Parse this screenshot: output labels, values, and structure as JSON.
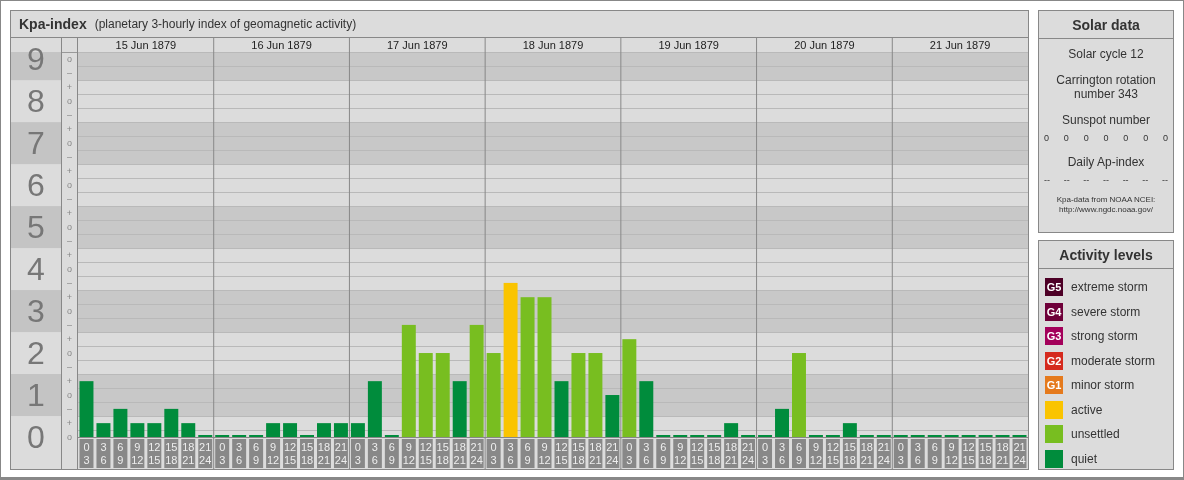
{
  "title": {
    "name": "Kpa-index",
    "subtitle": "(planetary 3-hourly index of geomagnetic activity)"
  },
  "kp_chart": {
    "days": [
      "15 Jun 1879",
      "16 Jun 1879",
      "17 Jun 1879",
      "18 Jun 1879",
      "19 Jun 1879",
      "20 Jun 1879",
      "21 Jun 1879"
    ],
    "scale_marks": [
      "o",
      "–",
      "+",
      "o",
      "–",
      "+",
      "o",
      "–",
      "+",
      "o",
      "–",
      "+",
      "o",
      "–",
      "+",
      "o",
      "–",
      "+",
      "o",
      "–",
      "+",
      "o",
      "–",
      "+",
      "o",
      "–",
      "+",
      "o"
    ],
    "chart_data": {
      "type": "bar",
      "grid": true,
      "ylim": [
        0,
        9.17
      ],
      "yticks": [
        {
          "value": 9,
          "label": "9"
        },
        {
          "value": 8,
          "label": "8"
        },
        {
          "value": 7,
          "label": "7"
        },
        {
          "value": 6,
          "label": "6"
        },
        {
          "value": 5,
          "label": "5"
        },
        {
          "value": 4,
          "label": "4"
        },
        {
          "value": 3,
          "label": "3"
        },
        {
          "value": 2,
          "label": "2"
        },
        {
          "value": 1,
          "label": "1"
        },
        {
          "value": 0,
          "label": "0"
        }
      ],
      "categories": [
        "0 3",
        "3 6",
        "6 9",
        "9 12",
        "12 15",
        "15 18",
        "18 21",
        "21 24",
        "0 3",
        "3 6",
        "6 9",
        "9 12",
        "12 15",
        "15 18",
        "18 21",
        "21 24",
        "0 3",
        "3 6",
        "6 9",
        "9 12",
        "12 15",
        "15 18",
        "18 21",
        "21 24",
        "0 3",
        "3 6",
        "6 9",
        "9 12",
        "12 15",
        "15 18",
        "18 21",
        "21 24",
        "0 3",
        "3 6",
        "6 9",
        "9 12",
        "12 15",
        "15 18",
        "18 21",
        "21 24",
        "0 3",
        "3 6",
        "6 9",
        "9 12",
        "12 15",
        "15 18",
        "18 21",
        "21 24",
        "0 3",
        "3 6",
        "6 9",
        "9 12",
        "12 15",
        "15 18",
        "18 21",
        "21 24"
      ],
      "series": [
        {
          "color": "#008c3c",
          "values": [
            1.33,
            0.33,
            0.67,
            0.33,
            0.33,
            0.67,
            0.33,
            0,
            0,
            0,
            0,
            0.33,
            0.33,
            0,
            0.33,
            0.33,
            0.33,
            1.33,
            0,
            null,
            null,
            null,
            1.33,
            null,
            null,
            null,
            null,
            null,
            1.33,
            null,
            null,
            1,
            null,
            1.33,
            0,
            0,
            0,
            0,
            0.33,
            0,
            0,
            0.67,
            null,
            0,
            0,
            0.33,
            0,
            0,
            0,
            0,
            0,
            0,
            0,
            0,
            0,
            0
          ]
        },
        {
          "color": "#78be20",
          "values": [
            null,
            null,
            null,
            null,
            null,
            null,
            null,
            null,
            null,
            null,
            null,
            null,
            null,
            null,
            null,
            null,
            null,
            null,
            null,
            2.67,
            2,
            2,
            null,
            2.67,
            2,
            null,
            3.33,
            3.33,
            null,
            2,
            2,
            null,
            2.33,
            null,
            null,
            null,
            null,
            null,
            null,
            null,
            null,
            null,
            2,
            null,
            null,
            null,
            null,
            null,
            null,
            null,
            null,
            null,
            null,
            null,
            null,
            null
          ]
        },
        {
          "color": "#fac400",
          "values": [
            null,
            null,
            null,
            null,
            null,
            null,
            null,
            null,
            null,
            null,
            null,
            null,
            null,
            null,
            null,
            null,
            null,
            null,
            null,
            null,
            null,
            null,
            null,
            null,
            null,
            3.67,
            null,
            null,
            null,
            null,
            null,
            null,
            null,
            null,
            null,
            null,
            null,
            null,
            null,
            null,
            null,
            null,
            null,
            null,
            null,
            null,
            null,
            null,
            null,
            null,
            null,
            null,
            null,
            null,
            null,
            null
          ]
        }
      ]
    }
  },
  "solar_data": {
    "title": "Solar data",
    "solar_cycle": "Solar cycle 12",
    "carrington": "Carrington rotation number 343",
    "sunspot_label": "Sunspot number",
    "sunspot_values": [
      "0",
      "0",
      "0",
      "0",
      "0",
      "0",
      "0"
    ],
    "ap_label": "Daily Ap-index",
    "ap_values": [
      "--",
      "--",
      "--",
      "--",
      "--",
      "--",
      "--"
    ],
    "source": "Kpa-data from NOAA NCEI:",
    "source_url": "http://www.ngdc.noaa.gov/"
  },
  "activity_levels": {
    "title": "Activity levels",
    "items": [
      {
        "badge": "G5",
        "label": "extreme storm",
        "color": "#4d0026"
      },
      {
        "badge": "G4",
        "label": "severe storm",
        "color": "#6e0039"
      },
      {
        "badge": "G3",
        "label": "strong storm",
        "color": "#a3005a"
      },
      {
        "badge": "G2",
        "label": "moderate storm",
        "color": "#d52a1e"
      },
      {
        "badge": "G1",
        "label": "minor storm",
        "color": "#e57a1d"
      },
      {
        "label": "active",
        "color": "#fac400"
      },
      {
        "label": "unsettled",
        "color": "#78be20"
      },
      {
        "label": "quiet",
        "color": "#008c3c"
      }
    ]
  }
}
